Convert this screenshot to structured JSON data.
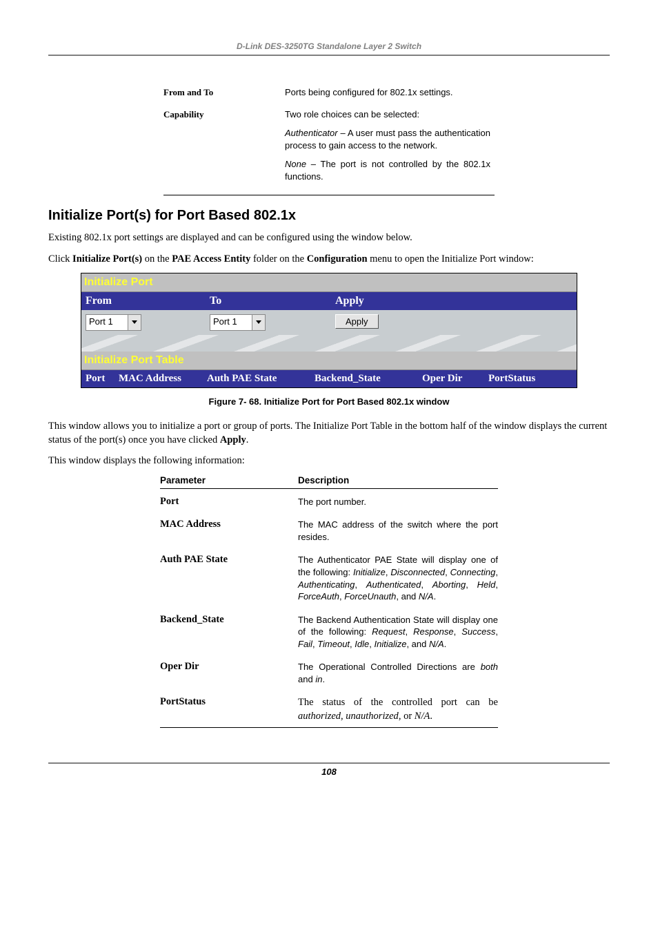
{
  "header": "D-Link DES-3250TG Standalone Layer 2 Switch",
  "table1": {
    "rows": [
      {
        "name": "From and To",
        "name_html": "<b>From</b> and <b>To</b>",
        "desc": "Ports being configured for 802.1x settings."
      },
      {
        "name": "Capability",
        "desc": "Two role choices can be selected:"
      }
    ],
    "extra": [
      "Authenticator – A user must pass the authentication process to gain access to the network.",
      "None – The port is not controlled by the 802.1x functions."
    ]
  },
  "section_heading": "Initialize Port(s) for Port Based 802.1x",
  "para1": "Existing 802.1x port settings are displayed and can be configured using the window below.",
  "para2_pre": "Click ",
  "para2_b1": "Initialize Port(s)",
  "para2_mid": " on the ",
  "para2_b2": "PAE Access Entity",
  "para2_mid2": " folder on the ",
  "para2_b3": "Configuration",
  "para2_end": " menu to open the Initialize Port window:",
  "screenshot": {
    "panel1_title": "Initialize Port",
    "hdr": {
      "c1": "From",
      "c2": "To",
      "c3": "Apply"
    },
    "from_value": "Port 1",
    "to_value": "Port 1",
    "apply_label": "Apply",
    "panel2_title": "Initialize Port Table",
    "cols": {
      "c1": "Port",
      "c2": "MAC Address",
      "c3": "Auth PAE State",
      "c4": "Backend_State",
      "c5": "Oper Dir",
      "c6": "PortStatus"
    }
  },
  "figure_caption": "Figure 7- 68.  Initialize Port for Port Based 802.1x window",
  "para3": "This window allows you to initialize a port or group of ports. The Initialize Port Table in the bottom half of the window displays the current status of the port(s) once you have clicked ",
  "para3_b": "Apply",
  "para3_end": ".",
  "para4": "This window displays the following information:",
  "table2_head": {
    "l": "Parameter",
    "r": "Description"
  },
  "table2": [
    {
      "name": "Port",
      "desc": "The port number."
    },
    {
      "name": "MAC Address",
      "desc": "The MAC address of the switch where the port resides."
    },
    {
      "name": "Auth PAE State",
      "desc_html": "The Authenticator PAE State will display one of the following: <i>Initialize</i>, <i>Disconnected</i>, <i>Connecting</i>, <i>Authenticating</i>, <i>Authenticated</i>, <i>Aborting</i>, <i>Held</i>, <i>ForceAuth</i>, <i>ForceUnauth</i>, and <i>N/A</i>."
    },
    {
      "name": "Backend_State",
      "desc_html": "The Backend Authentication State will display one of the following: <i>Request</i>, <i>Response</i>, <i>Success</i>, <i>Fail</i>, <i>Timeout</i>, <i>Idle</i>, <i>Initialize</i>, and <i>N/A</i>."
    },
    {
      "name": "Oper Dir",
      "desc_html": "The Operational Controlled Directions are <i>both</i> and <i>in</i>."
    },
    {
      "name": "PortStatus",
      "desc_times_html": "The status of the controlled port can be <i>authorized</i>, <i>unauthorized</i>, or <i>N/A</i>."
    }
  ],
  "page_number": "108"
}
